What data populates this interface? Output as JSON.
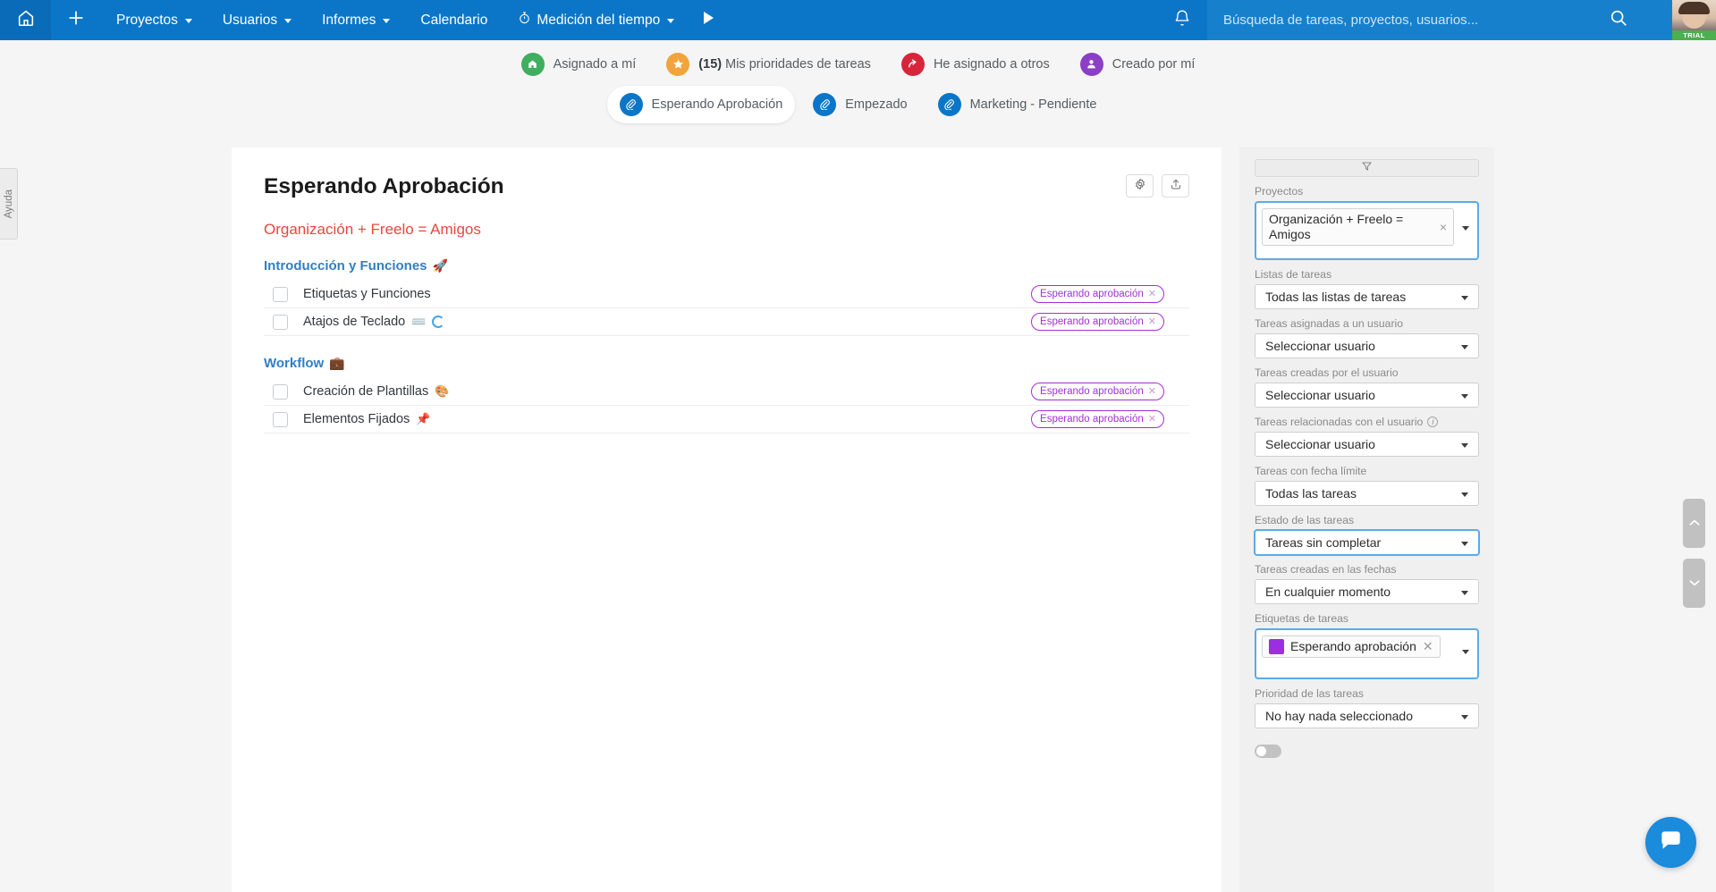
{
  "topnav": {
    "home_icon": "home-icon",
    "add_icon": "plus-icon",
    "items": [
      {
        "label": "Proyectos",
        "has_caret": true
      },
      {
        "label": "Usuarios",
        "has_caret": true
      },
      {
        "label": "Informes",
        "has_caret": true
      },
      {
        "label": "Calendario",
        "has_caret": false
      },
      {
        "label": "Medición del tiempo",
        "has_caret": true
      }
    ],
    "play_icon": "play-icon",
    "bell_icon": "bell-icon",
    "search": {
      "placeholder": "Búsqueda de tareas, proyectos, usuarios...",
      "value": "",
      "icon": "search-icon"
    },
    "avatar_label": "avatar",
    "trial_badge": "TRIAL"
  },
  "pillbar": {
    "row1": [
      {
        "label": "Asignado a mí",
        "count": "",
        "icon": "home-icon",
        "color": "#3fae5e",
        "active": false
      },
      {
        "label": "Mis prioridades de tareas",
        "count": "(15)",
        "icon": "star-icon",
        "color": "#f1a43c",
        "active": false
      },
      {
        "label": "He asignado a otros",
        "count": "",
        "icon": "arrow-curve-icon",
        "color": "#d8253b",
        "active": false
      },
      {
        "label": "Creado por mí",
        "count": "",
        "icon": "user-icon",
        "color": "#8b3fc4",
        "active": false
      }
    ],
    "row2": [
      {
        "label": "Esperando Aprobación",
        "count": "",
        "icon": "paperclip-icon",
        "color": "#0b76c8",
        "active": true
      },
      {
        "label": "Empezado",
        "count": "",
        "icon": "paperclip-icon",
        "color": "#0b76c8",
        "active": false
      },
      {
        "label": "Marketing - Pendiente",
        "count": "",
        "icon": "paperclip-icon",
        "color": "#0b76c8",
        "active": false
      }
    ]
  },
  "help_tab": {
    "label": "Ayuda"
  },
  "main": {
    "title": "Esperando Aprobación",
    "settings_icon": "gear-icon",
    "export_icon": "upload-icon",
    "project_name": "Organización + Freelo = Amigos",
    "tag_color": "#a32fd6",
    "sections": [
      {
        "title": "Introducción y Funciones",
        "emoji": "🚀",
        "tasks": [
          {
            "name": "Etiquetas y Funciones",
            "emoji": "",
            "spinner": false,
            "tag": "Esperando aprobación"
          },
          {
            "name": "Atajos de Teclado",
            "emoji": "⌨️",
            "spinner": true,
            "tag": "Esperando aprobación"
          }
        ]
      },
      {
        "title": "Workflow",
        "emoji": "💼",
        "tasks": [
          {
            "name": "Creación de Plantillas",
            "emoji": "🎨",
            "spinner": false,
            "tag": "Esperando aprobación"
          },
          {
            "name": "Elementos Fijados",
            "emoji": "📌",
            "spinner": false,
            "tag": "Esperando aprobación"
          }
        ]
      }
    ]
  },
  "filters": {
    "filter_icon": "funnel-icon",
    "projects": {
      "label": "Proyectos",
      "chip": "Organización + Freelo = Amigos",
      "chip_remove": "×"
    },
    "task_lists": {
      "label": "Listas de tareas",
      "value": "Todas las listas de tareas"
    },
    "assigned_to": {
      "label": "Tareas asignadas a un usuario",
      "value": "Seleccionar usuario"
    },
    "created_by": {
      "label": "Tareas creadas por el usuario",
      "value": "Seleccionar usuario"
    },
    "related_to": {
      "label": "Tareas relacionadas con el usuario",
      "value": "Seleccionar usuario",
      "info_icon": "info-icon"
    },
    "due_date": {
      "label": "Tareas con fecha límite",
      "value": "Todas las tareas"
    },
    "status": {
      "label": "Estado de las tareas",
      "value": "Tareas sin completar"
    },
    "created_on": {
      "label": "Tareas creadas en las fechas",
      "value": "En cualquier momento"
    },
    "tags": {
      "label": "Etiquetas de tareas",
      "chip": "Esperando aprobación",
      "chip_color": "#9b2ee0",
      "chip_remove": "✕"
    },
    "priority": {
      "label": "Prioridad de las tareas",
      "value": "No hay nada seleccionado"
    }
  },
  "scroll": {
    "up_icon": "chevron-up-icon",
    "down_icon": "chevron-down-icon"
  },
  "chat": {
    "icon": "chat-icon"
  }
}
